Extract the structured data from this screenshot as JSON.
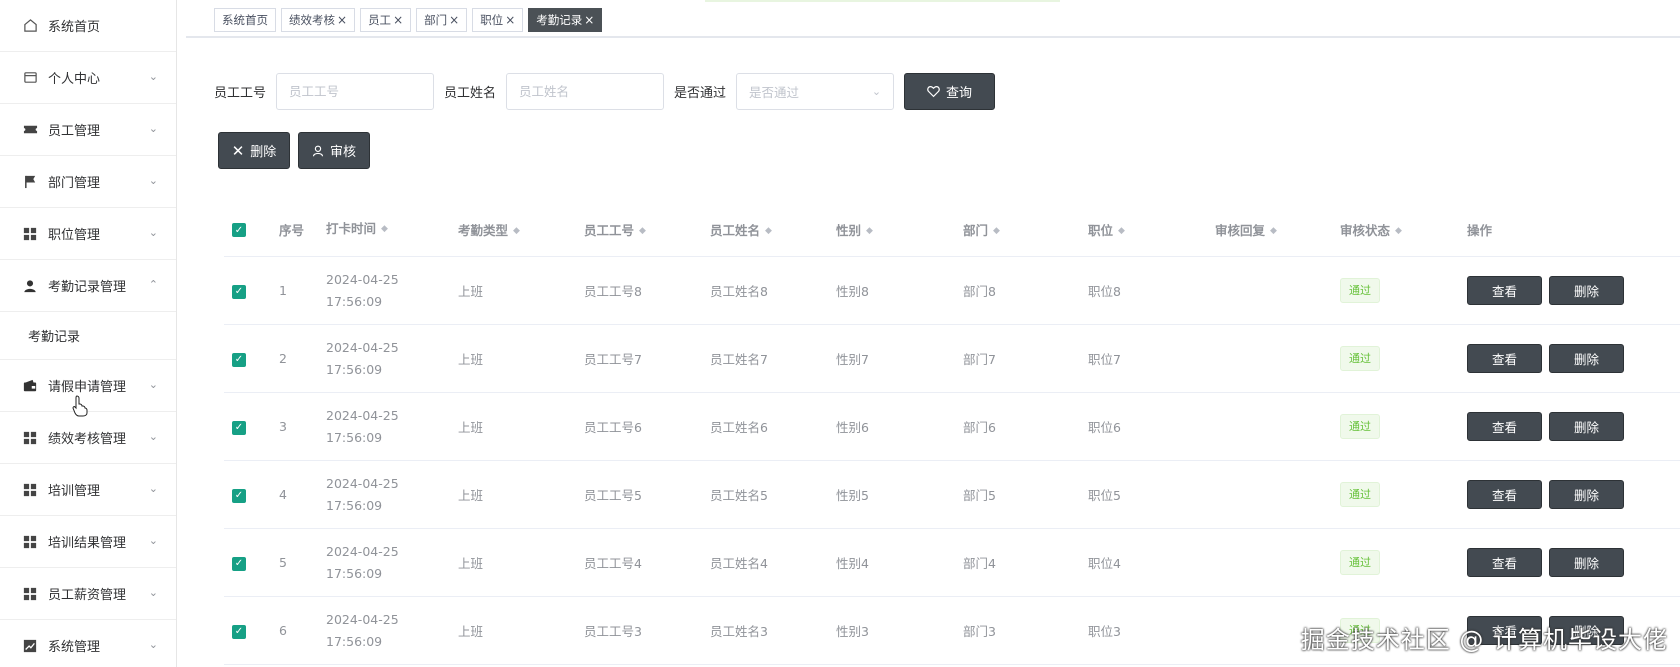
{
  "sidebar": {
    "items": [
      {
        "label": "系统首页",
        "icon": "home-icon"
      },
      {
        "label": "个人中心",
        "icon": "card-icon"
      },
      {
        "label": "员工管理",
        "icon": "ticket-icon"
      },
      {
        "label": "部门管理",
        "icon": "flag-icon"
      },
      {
        "label": "职位管理",
        "icon": "grid-icon"
      },
      {
        "label": "考勤记录管理",
        "icon": "user-icon"
      },
      {
        "label": "请假申请管理",
        "icon": "wallet-icon"
      },
      {
        "label": "绩效考核管理",
        "icon": "grid-icon"
      },
      {
        "label": "培训管理",
        "icon": "grid-icon"
      },
      {
        "label": "培训结果管理",
        "icon": "grid-icon"
      },
      {
        "label": "员工薪资管理",
        "icon": "grid-icon"
      },
      {
        "label": "系统管理",
        "icon": "chart-icon"
      }
    ],
    "sub_item": "考勤记录"
  },
  "tabs": [
    {
      "label": "系统首页",
      "closable": false
    },
    {
      "label": "绩效考核",
      "closable": true
    },
    {
      "label": "员工",
      "closable": true
    },
    {
      "label": "部门",
      "closable": true
    },
    {
      "label": "职位",
      "closable": true
    },
    {
      "label": "考勤记录",
      "closable": true,
      "active": true
    }
  ],
  "search": {
    "emp_no_label": "员工工号",
    "emp_no_placeholder": "员工工号",
    "emp_name_label": "员工姓名",
    "emp_name_placeholder": "员工姓名",
    "passed_label": "是否通过",
    "passed_placeholder": "是否通过",
    "query_button": "查询"
  },
  "actions": {
    "delete_button": "删除",
    "audit_button": "审核"
  },
  "table": {
    "headers": [
      "序号",
      "打卡时间",
      "考勤类型",
      "员工工号",
      "员工姓名",
      "性别",
      "部门",
      "职位",
      "审核回复",
      "审核状态",
      "操作"
    ],
    "rows": [
      {
        "idx": "1",
        "time": "2024-04-25 17:56:09",
        "type": "上班",
        "no": "员工工号8",
        "name": "员工姓名8",
        "sex": "性别8",
        "dept": "部门8",
        "pos": "职位8",
        "reply": "",
        "status": "通过"
      },
      {
        "idx": "2",
        "time": "2024-04-25 17:56:09",
        "type": "上班",
        "no": "员工工号7",
        "name": "员工姓名7",
        "sex": "性别7",
        "dept": "部门7",
        "pos": "职位7",
        "reply": "",
        "status": "通过"
      },
      {
        "idx": "3",
        "time": "2024-04-25 17:56:09",
        "type": "上班",
        "no": "员工工号6",
        "name": "员工姓名6",
        "sex": "性别6",
        "dept": "部门6",
        "pos": "职位6",
        "reply": "",
        "status": "通过"
      },
      {
        "idx": "4",
        "time": "2024-04-25 17:56:09",
        "type": "上班",
        "no": "员工工号5",
        "name": "员工姓名5",
        "sex": "性别5",
        "dept": "部门5",
        "pos": "职位5",
        "reply": "",
        "status": "通过"
      },
      {
        "idx": "5",
        "time": "2024-04-25 17:56:09",
        "type": "上班",
        "no": "员工工号4",
        "name": "员工姓名4",
        "sex": "性别4",
        "dept": "部门4",
        "pos": "职位4",
        "reply": "",
        "status": "通过"
      },
      {
        "idx": "6",
        "time": "2024-04-25 17:56:09",
        "type": "上班",
        "no": "员工工号3",
        "name": "员工姓名3",
        "sex": "性别3",
        "dept": "部门3",
        "pos": "职位3",
        "reply": "",
        "status": "通过"
      }
    ],
    "view_button": "查看",
    "delete_button": "删除"
  },
  "watermark": "掘金技术社区 @ 计算机毕设大佬",
  "colors": {
    "button_dark": "#434a51",
    "checkbox": "#16a085",
    "tag_text": "#67c23a",
    "tag_bg": "#f0f9eb"
  }
}
